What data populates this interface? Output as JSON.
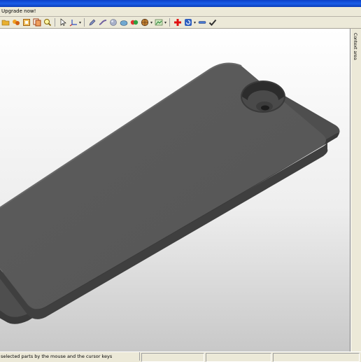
{
  "upgrade_bar": {
    "text": "Upgrade now!"
  },
  "toolbar": {
    "icons": [
      "open-folder-icon",
      "coins-icon",
      "frame-icon",
      "copy-icon",
      "zoom-icon",
      "select-arrow-icon",
      "axes-icon",
      "pen-icon",
      "bend-icon",
      "sphere-icon",
      "shading-icon",
      "material-icon",
      "globe-icon",
      "add-icon",
      "rotate-icon",
      "minus-icon",
      "check-icon"
    ],
    "colors": {
      "add": "#e01010",
      "accent": "#2050c0",
      "check": "#303030"
    }
  },
  "right_panel": {
    "label": "Context area"
  },
  "status_bar": {
    "message": "selected parts by the mouse and the cursor keys"
  },
  "viewport": {
    "model_color": "#555555",
    "background_top": "#ffffff",
    "background_bottom": "#c8c8c8"
  }
}
